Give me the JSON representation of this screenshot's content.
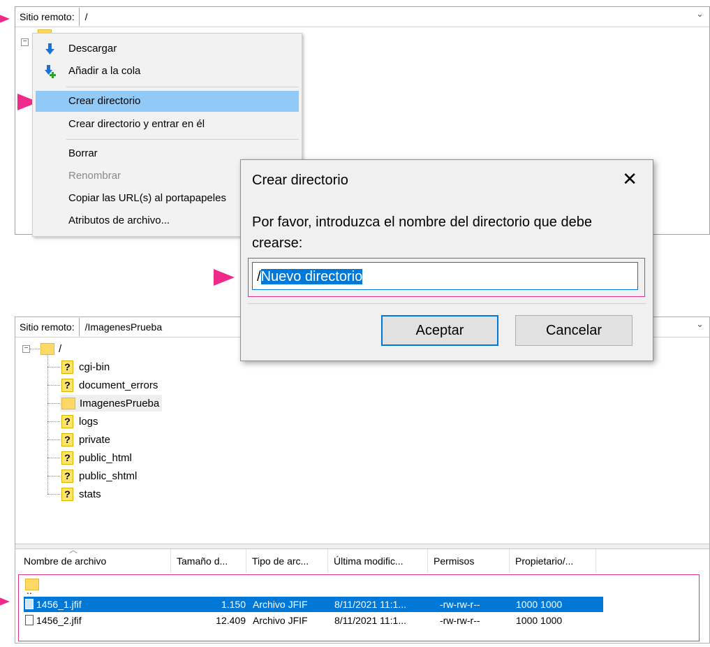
{
  "top_panel": {
    "remote_label": "Sitio remoto:",
    "remote_path": "/"
  },
  "context_menu": {
    "items": [
      {
        "label": "Descargar",
        "icon": "download-icon",
        "state": "normal"
      },
      {
        "label": "Añadir a la cola",
        "icon": "add-to-queue-icon",
        "state": "normal"
      },
      {
        "label": "Crear directorio",
        "state": "highlighted"
      },
      {
        "label": "Crear directorio y entrar en él",
        "state": "normal"
      },
      {
        "label": "Borrar",
        "state": "normal"
      },
      {
        "label": "Renombrar",
        "state": "disabled"
      },
      {
        "label": "Copiar las URL(s) al portapapeles",
        "state": "normal"
      },
      {
        "label": "Atributos de archivo...",
        "state": "normal"
      }
    ]
  },
  "dialog": {
    "title": "Crear directorio",
    "close_glyph": "✕",
    "message": "Por favor, introduzca el nombre del directorio que debe crearse:",
    "input_prefix": "/",
    "input_selected": "Nuevo directorio",
    "ok_label": "Aceptar",
    "cancel_label": "Cancelar"
  },
  "bottom_panel": {
    "remote_label": "Sitio remoto:",
    "remote_path": "/ImagenesPrueba",
    "tree_root": "/",
    "tree_items": [
      {
        "name": "cgi-bin",
        "icon": "unknown-folder-icon"
      },
      {
        "name": "document_errors",
        "icon": "unknown-folder-icon"
      },
      {
        "name": "ImagenesPrueba",
        "icon": "folder-icon",
        "selected": true
      },
      {
        "name": "logs",
        "icon": "unknown-folder-icon"
      },
      {
        "name": "private",
        "icon": "unknown-folder-icon"
      },
      {
        "name": "public_html",
        "icon": "unknown-folder-icon"
      },
      {
        "name": "public_shtml",
        "icon": "unknown-folder-icon"
      },
      {
        "name": "stats",
        "icon": "unknown-folder-icon"
      }
    ]
  },
  "file_list": {
    "columns": [
      "Nombre de archivo",
      "Tamaño d...",
      "Tipo de arc...",
      "Última modific...",
      "Permisos",
      "Propietario/..."
    ],
    "parent_dir": "..",
    "rows": [
      {
        "name": "1456_1.jfif",
        "size": "1.150",
        "type": "Archivo JFIF",
        "modified": "8/11/2021 11:1...",
        "perms": "-rw-rw-r--",
        "owner": "1000 1000",
        "selected": true
      },
      {
        "name": "1456_2.jfif",
        "size": "12.409",
        "type": "Archivo JFIF",
        "modified": "8/11/2021 11:1...",
        "perms": "-rw-rw-r--",
        "owner": "1000 1000",
        "selected": false
      }
    ]
  },
  "colors": {
    "arrow": "#ee2a8a",
    "menu_highlight": "#91c9f7",
    "selection": "#0078d7"
  }
}
